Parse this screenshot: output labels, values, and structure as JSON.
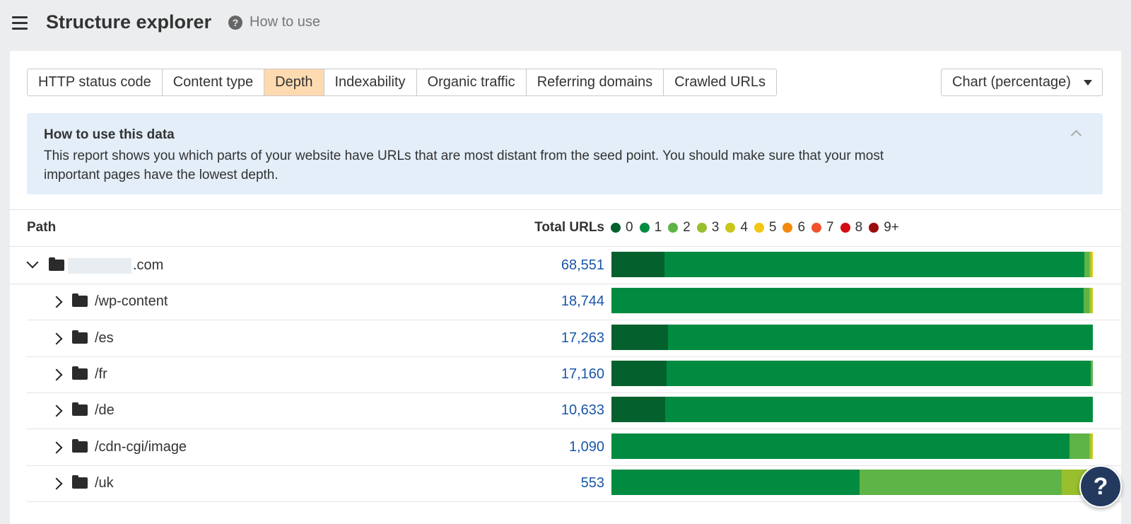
{
  "header": {
    "title": "Structure explorer",
    "help_link": "How to use",
    "help_icon": "question-circle-icon"
  },
  "tabs": [
    {
      "label": "HTTP status code",
      "active": false
    },
    {
      "label": "Content type",
      "active": false
    },
    {
      "label": "Depth",
      "active": true
    },
    {
      "label": "Indexability",
      "active": false
    },
    {
      "label": "Organic traffic",
      "active": false
    },
    {
      "label": "Referring domains",
      "active": false
    },
    {
      "label": "Crawled URLs",
      "active": false
    }
  ],
  "view_select": {
    "value": "Chart (percentage)"
  },
  "info": {
    "title": "How to use this data",
    "text": "This report shows you which parts of your website have URLs that are most distant from the seed point. You should make sure that your most important pages have the lowest depth."
  },
  "table": {
    "col_path": "Path",
    "col_total": "Total URLs"
  },
  "legend": [
    {
      "label": "0",
      "color": "#04612d"
    },
    {
      "label": "1",
      "color": "#018b41"
    },
    {
      "label": "2",
      "color": "#5eb446"
    },
    {
      "label": "3",
      "color": "#98bf2e"
    },
    {
      "label": "4",
      "color": "#c9c71c"
    },
    {
      "label": "5",
      "color": "#f5c611"
    },
    {
      "label": "6",
      "color": "#f28a0c"
    },
    {
      "label": "7",
      "color": "#f1522b"
    },
    {
      "label": "8",
      "color": "#d30d12"
    },
    {
      "label": "9+",
      "color": "#9d0c0c"
    }
  ],
  "rows": [
    {
      "path": ".com",
      "redacted": true,
      "total": "68,551",
      "expanded": true,
      "level": 0,
      "dist": [
        11,
        87.2,
        1.1,
        0.2,
        0.3,
        0.2,
        0,
        0,
        0,
        0
      ]
    },
    {
      "path": "/wp-content",
      "total": "18,744",
      "expanded": false,
      "level": 1,
      "dist": [
        0,
        98.1,
        1.2,
        0.3,
        0.4,
        0,
        0,
        0,
        0,
        0
      ]
    },
    {
      "path": "/es",
      "total": "17,263",
      "expanded": false,
      "level": 1,
      "dist": [
        11.7,
        88.3,
        0,
        0,
        0,
        0,
        0,
        0,
        0,
        0
      ]
    },
    {
      "path": "/fr",
      "total": "17,160",
      "expanded": false,
      "level": 1,
      "dist": [
        11.5,
        88.1,
        0.4,
        0,
        0,
        0,
        0,
        0,
        0,
        0
      ]
    },
    {
      "path": "/de",
      "total": "10,633",
      "expanded": false,
      "level": 1,
      "dist": [
        11.1,
        88.9,
        0,
        0,
        0,
        0,
        0,
        0,
        0,
        0
      ]
    },
    {
      "path": "/cdn-cgi/image",
      "total": "1,090",
      "expanded": false,
      "level": 1,
      "dist": [
        0,
        95.2,
        4.1,
        0.2,
        0.5,
        0,
        0,
        0,
        0,
        0
      ]
    },
    {
      "path": "/uk",
      "total": "553",
      "expanded": false,
      "level": 1,
      "dist": [
        0,
        51.5,
        42.1,
        6.4,
        0,
        0,
        0,
        0,
        0,
        0
      ]
    }
  ],
  "help_button": "?"
}
